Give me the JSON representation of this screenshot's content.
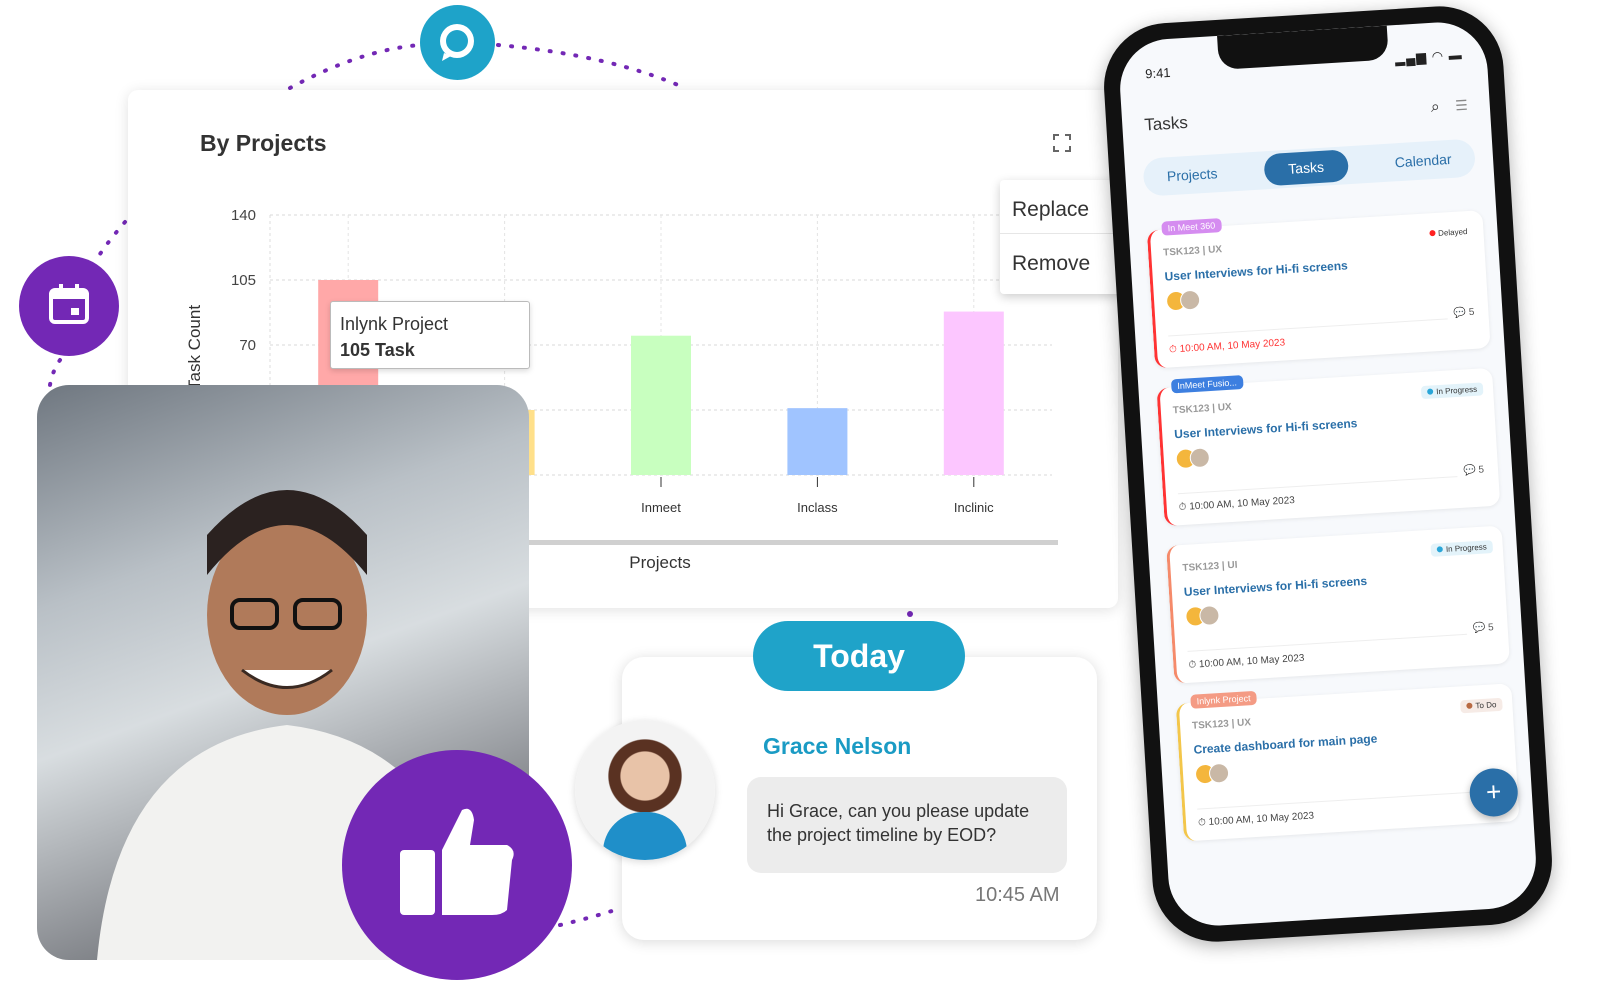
{
  "chart_card": {
    "title": "By Projects",
    "menu": [
      "Replace",
      "Remove"
    ],
    "tooltip": {
      "line1": "Inlynk Project",
      "line2": "105 Task"
    }
  },
  "chart_data": {
    "type": "bar",
    "title": "By Projects",
    "xlabel": "Projects",
    "ylabel": "Task Count",
    "ylim": [
      0,
      140
    ],
    "yticks": [
      140,
      105,
      70
    ],
    "categories": [
      "",
      "",
      "Inmeet",
      "Inclass",
      "Inclinic"
    ],
    "values": [
      105,
      35,
      75,
      36,
      88
    ],
    "colors": [
      "#ffa8a8",
      "#ffe08a",
      "#c8ffbf",
      "#a0c4ff",
      "#fcc6ff"
    ],
    "grid": true
  },
  "today": {
    "pill": "Today",
    "name": "Grace Nelson",
    "message": "Hi Grace, can you please update the project timeline by EOD?",
    "time": "10:45 AM"
  },
  "colors": {
    "purple": "#7328b5",
    "teal": "#1fa3c9",
    "blue": "#2a6fa8"
  },
  "phone": {
    "time": "9:41",
    "title": "Tasks",
    "tabs": [
      "Projects",
      "Tasks",
      "Calendar"
    ],
    "active_tab": "Tasks",
    "cards": [
      {
        "tag": "In Meet 360",
        "tag_color": "#d58cf0",
        "meta": "TSK123 | UX",
        "status": "Delayed",
        "status_color": "#f22",
        "title": "User Interviews for Hi-fi screens",
        "due": "10:00 AM, 10 May 2023",
        "comments": "5",
        "border": "#f33"
      },
      {
        "tag": "InMeet Fusio...",
        "tag_color": "#3d7fe0",
        "meta": "TSK123 | UX",
        "status": "In Progress",
        "status_color": "#2aa6d8",
        "title": "User Interviews for Hi-fi screens",
        "due": "10:00 AM, 10 May 2023",
        "comments": "5",
        "border": "#f33"
      },
      {
        "tag": "",
        "tag_color": "",
        "meta": "TSK123 | UI",
        "status": "In Progress",
        "status_color": "#2aa6d8",
        "title": "User Interviews for Hi-fi screens",
        "due": "10:00 AM, 10 May 2023",
        "comments": "5",
        "border": "#f58a6a"
      },
      {
        "tag": "Inlynk Project",
        "tag_color": "#f49b84",
        "meta": "TSK123 | UX",
        "status": "To Do",
        "status_color": "#b86a43",
        "title": "Create dashboard for main page",
        "due": "10:00 AM, 10 May 2023",
        "comments": "5",
        "border": "#f3c64a"
      }
    ],
    "fab": "+"
  }
}
